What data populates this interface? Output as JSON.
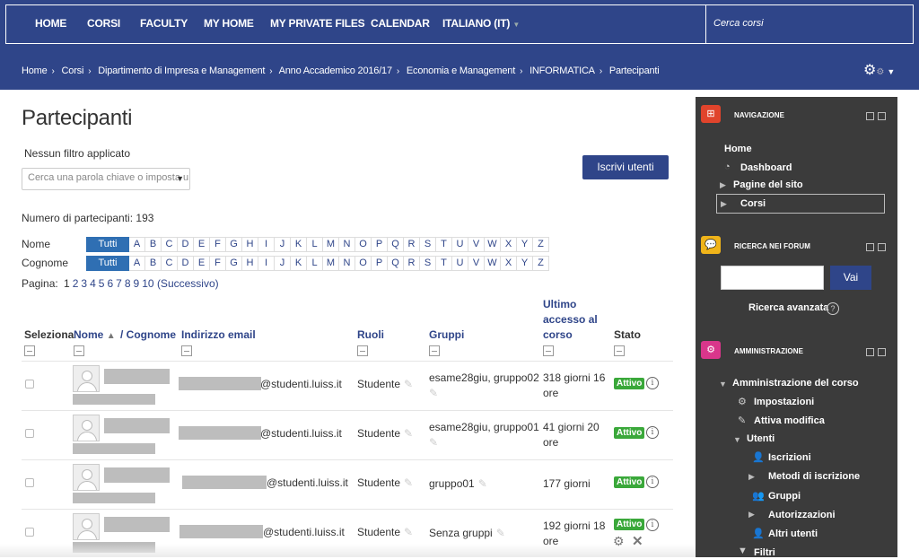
{
  "nav": {
    "items": [
      "HOME",
      "CORSI",
      "FACULTY",
      "MY HOME",
      "MY PRIVATE FILES",
      "CALENDAR",
      "ITALIANO (IT)"
    ],
    "search_placeholder": "Cerca corsi"
  },
  "breadcrumb": [
    "Home",
    "Corsi",
    "Dipartimento di Impresa e Management",
    "Anno Accademico 2016/17",
    "Economia e Management",
    "INFORMATICA",
    "Partecipanti"
  ],
  "page": {
    "title": "Partecipanti",
    "filter_label": "Nessun filtro applicato",
    "filter_placeholder": "Cerca una parola chiave o imposta u",
    "enrol_button": "Iscrivi utenti",
    "participant_count": "Numero di partecipanti: 193",
    "first_name_label": "Nome",
    "last_name_label": "Cognome",
    "all_label": "Tutti",
    "letters": [
      "A",
      "B",
      "C",
      "D",
      "E",
      "F",
      "G",
      "H",
      "I",
      "J",
      "K",
      "L",
      "M",
      "N",
      "O",
      "P",
      "Q",
      "R",
      "S",
      "T",
      "U",
      "V",
      "W",
      "X",
      "Y",
      "Z"
    ],
    "pagination_prefix": "Pagina:",
    "pages": [
      "1",
      "2",
      "3",
      "4",
      "5",
      "6",
      "7",
      "8",
      "9",
      "10"
    ],
    "next_label": "(Successivo)"
  },
  "table": {
    "headers": {
      "select": "Seleziona",
      "first_name": "Nome",
      "last_name": "/ Cognome",
      "email": "Indirizzo email",
      "roles": "Ruoli",
      "groups": "Gruppi",
      "last_access_1": "Ultimo",
      "last_access_2": "accesso al",
      "last_access_3": "corso",
      "status": "Stato"
    },
    "rows": [
      {
        "email": "@studenti.luiss.it",
        "role": "Studente",
        "groups": "esame28giu, gruppo02",
        "access_1": "318 giorni 16",
        "access_2": "ore",
        "status": "Attivo"
      },
      {
        "email": "@studenti.luiss.it",
        "role": "Studente",
        "groups": "esame28giu, gruppo01",
        "access_1": "41 giorni 20",
        "access_2": "ore",
        "status": "Attivo"
      },
      {
        "email": "@studenti.luiss.it",
        "role": "Studente",
        "groups": "gruppo01",
        "access_1": "177 giorni",
        "access_2": "",
        "status": "Attivo"
      },
      {
        "email": "@studenti.luiss.it",
        "role": "Studente",
        "groups": "Senza gruppi",
        "access_1": "192 giorni 18",
        "access_2": "ore",
        "status": "Attivo"
      }
    ]
  },
  "sidebar": {
    "nav_title": "NAVIGAZIONE",
    "nav_items": [
      "Home",
      "Dashboard",
      "Pagine del sito",
      "Corsi"
    ],
    "forum_title": "RICERCA NEI FORUM",
    "forum_button": "Vai",
    "forum_advanced": "Ricerca avanzata",
    "admin_title": "AMMINISTRAZIONE",
    "admin_items": [
      "Amministrazione del corso",
      "Impostazioni",
      "Attiva modifica",
      "Utenti",
      "Iscrizioni",
      "Metodi di iscrizione",
      "Gruppi",
      "Autorizzazioni",
      "Altri utenti",
      "Filtri"
    ]
  },
  "colors": {
    "brand": "#2f4589",
    "status_active": "#3aa83a",
    "sidebar_bg": "#3b3b3b"
  }
}
